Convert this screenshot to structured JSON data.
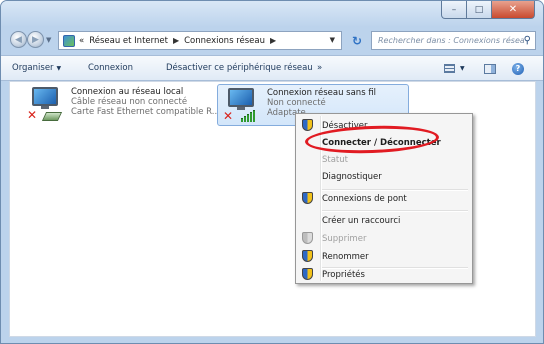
{
  "window": {
    "caption_buttons": {
      "minimize": "–",
      "maximize": "□",
      "close": "✕"
    }
  },
  "address": {
    "back_icon": "back-arrow-icon",
    "forward_icon": "forward-arrow-icon",
    "overflow": "«",
    "crumbs": [
      "Réseau et Internet",
      "Connexions réseau"
    ],
    "refresh_icon": "refresh-icon",
    "search_placeholder": "Rechercher dans : Connexions réseau"
  },
  "toolbar": {
    "organize": "Organiser",
    "connect": "Connexion",
    "disable": "Désactiver ce périphérique réseau",
    "more": "»"
  },
  "connections": [
    {
      "name": "Connexion au réseau local",
      "status": "Câble réseau non connecté",
      "device": "Carte Fast Ethernet compatible R..."
    },
    {
      "name": "Connexion réseau sans fil",
      "status": "Non connecté",
      "device": "Adaptate"
    }
  ],
  "context_menu": {
    "items": [
      {
        "label": "Désactiver",
        "icon": "shield-icon"
      },
      {
        "label": "Connecter / Déconnecter",
        "bold": true
      },
      {
        "label": "Statut",
        "disabled": true
      },
      {
        "label": "Diagnostiquer"
      },
      {
        "label": "Connexions de pont",
        "icon": "shield-icon"
      },
      {
        "label": "Créer un raccourci"
      },
      {
        "label": "Supprimer",
        "icon": "shield-icon",
        "disabled": true
      },
      {
        "label": "Renommer",
        "icon": "shield-icon"
      },
      {
        "label": "Propriétés",
        "icon": "shield-icon"
      }
    ]
  },
  "colors": {
    "highlight": "#e11b22",
    "window_frame": "#bcd3ec"
  }
}
